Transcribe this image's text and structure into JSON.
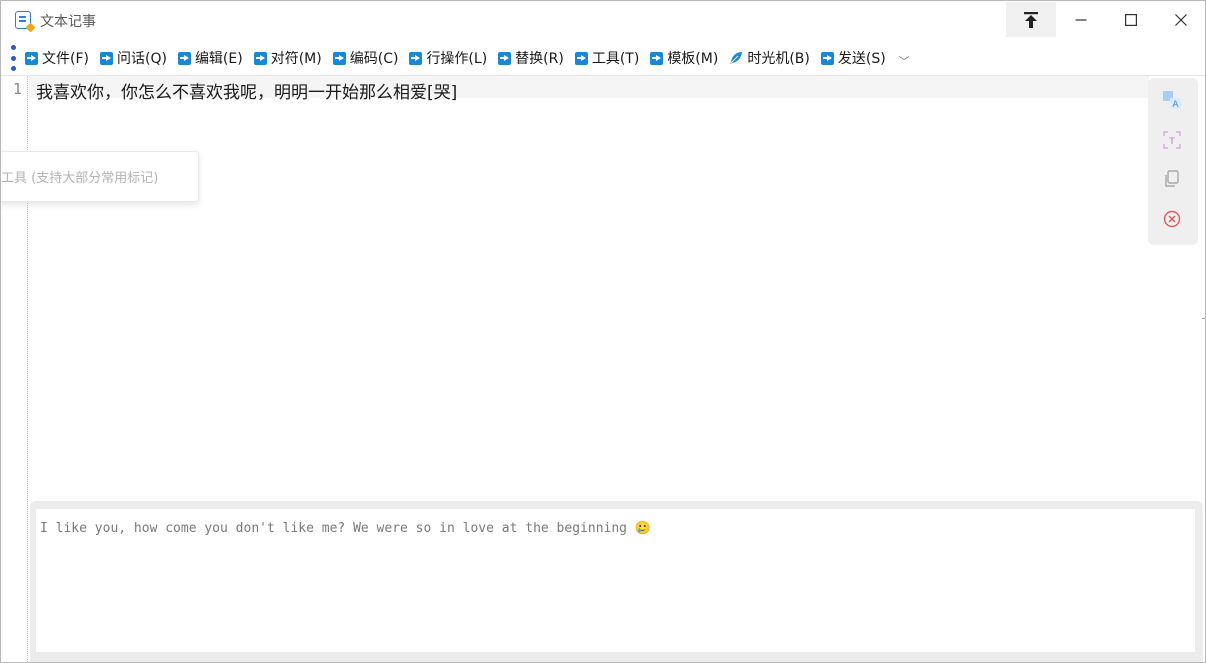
{
  "window": {
    "title": "文本记事",
    "minimize_glyph": "—",
    "maximize_glyph": "☐",
    "close_glyph": "✕"
  },
  "menu": {
    "items": [
      {
        "label": "文件(F)",
        "icon": "arrow-right-icon"
      },
      {
        "label": "问话(Q)",
        "icon": "arrow-right-icon"
      },
      {
        "label": "编辑(E)",
        "icon": "arrow-right-icon"
      },
      {
        "label": "对符(M)",
        "icon": "arrow-right-icon"
      },
      {
        "label": "编码(C)",
        "icon": "arrow-right-icon"
      },
      {
        "label": "行操作(L)",
        "icon": "arrow-right-icon"
      },
      {
        "label": "替换(R)",
        "icon": "arrow-right-icon"
      },
      {
        "label": "工具(T)",
        "icon": "arrow-right-icon"
      },
      {
        "label": "模板(M)",
        "icon": "arrow-right-icon"
      },
      {
        "label": "时光机(B)",
        "icon": "feather-icon"
      },
      {
        "label": "发送(S)",
        "icon": "arrow-right-icon"
      }
    ],
    "more_glyph": "﹀"
  },
  "editor": {
    "line_number": "1",
    "line_text": "我喜欢你，你怎么不喜欢我呢，明明一开始那么相爱[哭]",
    "hint_text": "工具 (支持大部分常用标记)"
  },
  "side_tools": [
    "translate-icon",
    "ocr-icon",
    "copy-icon",
    "clear-icon"
  ],
  "translation": {
    "text": "I like you, how come you don't like me? We were so in love at the beginning",
    "emoji": "🥲"
  },
  "colors": {
    "accent": "#1a86d6",
    "menu_dots": "#2a5ac8",
    "clear_icon": "#e05a5a",
    "ocr_icon": "#c46fd0",
    "translate_icon": "#3f8ee6"
  }
}
